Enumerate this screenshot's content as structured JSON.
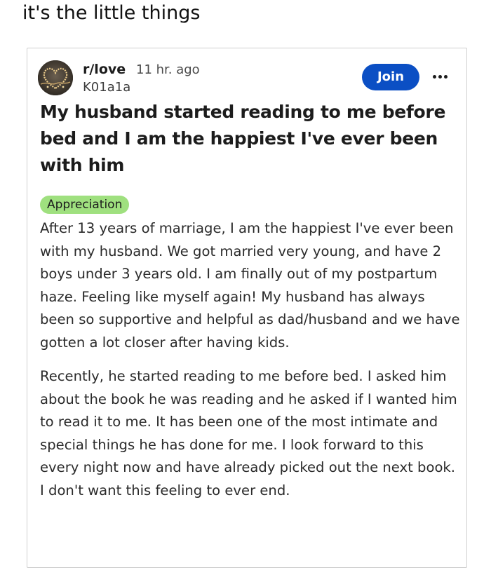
{
  "caption": "it's the little things",
  "post": {
    "subreddit": "r/love",
    "time_ago": "11 hr. ago",
    "username": "K01a1a",
    "join_label": "Join",
    "more_icon": "more-dots-icon",
    "title": "My husband started reading to me before bed and I am the happiest I've ever been with him",
    "flair": "Appreciation",
    "flair_color": "#9fe07f",
    "join_color": "#0b4fc4",
    "body": [
      "After 13 years of marriage, I am the happiest I've ever been with my husband. We got married very young, and have 2 boys under 3 years old. I am finally out of my postpartum haze. Feeling like myself again! My husband has always been so supportive and helpful as dad/husband and we have gotten a lot closer after having kids.",
      "Recently, he started reading to me before bed. I asked him about the book he was reading and he asked if I wanted him to read it to me. It has been one of the most intimate and special things he has done for me. I look forward to this every night now and have already picked out the next book. I don't want this feeling to ever end."
    ]
  }
}
